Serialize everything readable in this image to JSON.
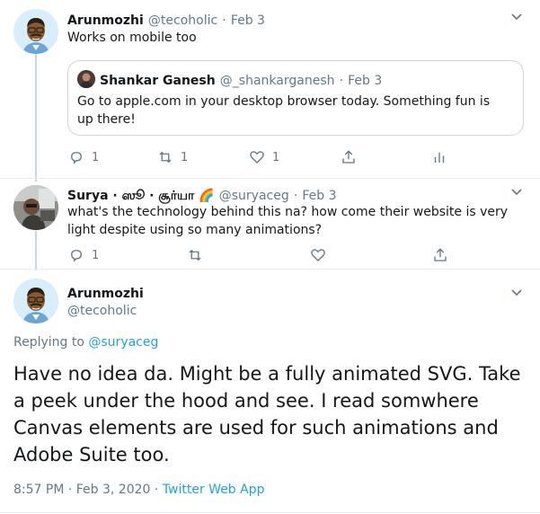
{
  "tweet1": {
    "name": "Arunmozhi",
    "handle": "@tecoholic",
    "sep": "·",
    "date": "Feb 3",
    "text": "Works on mobile too",
    "quote": {
      "name": "Shankar Ganesh",
      "handle": "@_shankarganesh",
      "sep": "·",
      "date": "Feb 3",
      "text": "Go to apple.com in your desktop browser today. Something fun is up there!"
    },
    "replies": "1",
    "retweets": "1",
    "likes": "1"
  },
  "tweet2": {
    "name": "Surya · ஸூ · சூர்யா 🌈",
    "handle": "@suryaceg",
    "sep": "·",
    "date": "Feb 3",
    "text": "what's the technology behind this na? how come their website is very light despite using so many animations?",
    "replies": "1"
  },
  "main": {
    "name": "Arunmozhi",
    "handle": "@tecoholic",
    "replying_label": "Replying to",
    "replying_to": "@suryaceg",
    "text": "Have no idea da. Might be a fully animated SVG. Take a peek under the hood and see. I read somwhere Canvas elements are used for such animations and Adobe Suite too.",
    "timestamp": "8:57 PM · Feb 3, 2020 ·",
    "source": "Twitter Web App"
  },
  "colors": {
    "accent": "#1da1f2",
    "muted": "#657786",
    "border": "#ccd6dd"
  }
}
